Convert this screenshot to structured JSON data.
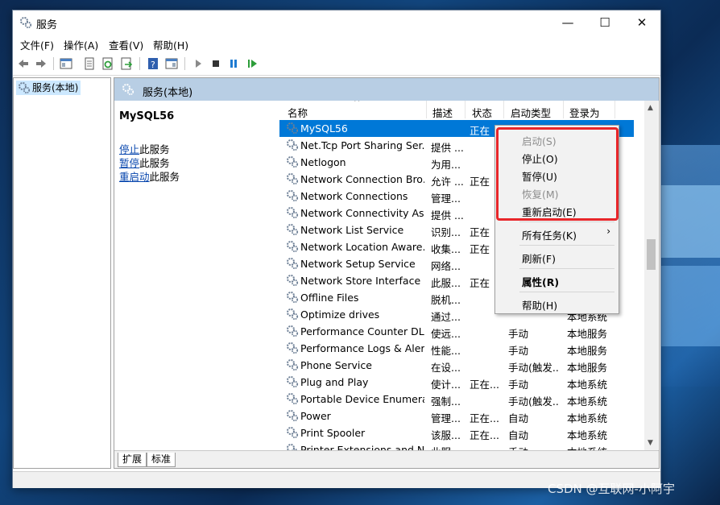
{
  "window": {
    "title": "服务",
    "minimize": "—",
    "maximize": "☐",
    "close": "✕"
  },
  "menu": [
    "文件(F)",
    "操作(A)",
    "查看(V)",
    "帮助(H)"
  ],
  "toolbar": [
    "back-icon",
    "forward-icon",
    "show-hide-tree-icon",
    "properties-icon",
    "refresh-icon",
    "export-icon",
    "help-icon",
    "show-hide-action-pane-icon",
    "start-service-icon",
    "stop-service-icon",
    "pause-service-icon",
    "restart-service-icon"
  ],
  "tree": {
    "label": "服务(本地)"
  },
  "pane": {
    "title": "服务(本地)"
  },
  "desc": {
    "service_name": "MySQL56",
    "actions": [
      {
        "link": "停止",
        "suffix": "此服务"
      },
      {
        "link": "暂停",
        "suffix": "此服务"
      },
      {
        "link": "重启动",
        "suffix": "此服务"
      }
    ]
  },
  "columns": [
    "名称",
    "描述",
    "状态",
    "启动类型",
    "登录为"
  ],
  "rows": [
    {
      "name": "MySQL56",
      "desc": "",
      "status": "正在",
      "start": "",
      "logon": "",
      "selected": true
    },
    {
      "name": "Net.Tcp Port Sharing Ser...",
      "desc": "提供 ...",
      "status": "",
      "start": "",
      "logon": ""
    },
    {
      "name": "Netlogon",
      "desc": "为用...",
      "status": "",
      "start": "",
      "logon": ""
    },
    {
      "name": "Network Connection Bro...",
      "desc": "允许 ...",
      "status": "正在",
      "start": "",
      "logon": ""
    },
    {
      "name": "Network Connections",
      "desc": "管理...",
      "status": "",
      "start": "",
      "logon": ""
    },
    {
      "name": "Network Connectivity Ass...",
      "desc": "提供 ...",
      "status": "",
      "start": "",
      "logon": ""
    },
    {
      "name": "Network List Service",
      "desc": "识别...",
      "status": "正在",
      "start": "",
      "logon": ""
    },
    {
      "name": "Network Location Aware...",
      "desc": "收集...",
      "status": "正在",
      "start": "",
      "logon": ""
    },
    {
      "name": "Network Setup Service",
      "desc": "网络...",
      "status": "",
      "start": "",
      "logon": ""
    },
    {
      "name": "Network Store Interface ...",
      "desc": "此服...",
      "status": "正在",
      "start": "",
      "logon": ""
    },
    {
      "name": "Offline Files",
      "desc": "脱机...",
      "status": "",
      "start": "",
      "logon": ""
    },
    {
      "name": "Optimize drives",
      "desc": "通过...",
      "status": "",
      "start": "",
      "logon": "本地系统"
    },
    {
      "name": "Performance Counter DL...",
      "desc": "使远...",
      "status": "",
      "start": "手动",
      "logon": "本地服务"
    },
    {
      "name": "Performance Logs & Aler...",
      "desc": "性能...",
      "status": "",
      "start": "手动",
      "logon": "本地服务"
    },
    {
      "name": "Phone Service",
      "desc": "在设...",
      "status": "",
      "start": "手动(触发...",
      "logon": "本地服务"
    },
    {
      "name": "Plug and Play",
      "desc": "使计...",
      "status": "正在...",
      "start": "手动",
      "logon": "本地系统"
    },
    {
      "name": "Portable Device Enumera...",
      "desc": "强制...",
      "status": "",
      "start": "手动(触发...",
      "logon": "本地系统"
    },
    {
      "name": "Power",
      "desc": "管理...",
      "status": "正在...",
      "start": "自动",
      "logon": "本地系统"
    },
    {
      "name": "Print Spooler",
      "desc": "该服...",
      "status": "正在...",
      "start": "自动",
      "logon": "本地系统"
    },
    {
      "name": "Printer Extensions and N...",
      "desc": "此服...",
      "status": "",
      "start": "手动",
      "logon": "本地系统"
    }
  ],
  "tabs": [
    "扩展",
    "标准"
  ],
  "context_menu": [
    {
      "label": "启动(S)",
      "disabled": true
    },
    {
      "label": "停止(O)",
      "disabled": false
    },
    {
      "label": "暂停(U)",
      "disabled": false
    },
    {
      "label": "恢复(M)",
      "disabled": true
    },
    {
      "label": "重新启动(E)",
      "disabled": false
    },
    {
      "label": "所有任务(K)",
      "disabled": false,
      "submenu": true
    },
    {
      "label": "刷新(F)",
      "disabled": false
    },
    {
      "label": "属性(R)",
      "disabled": false,
      "bold": true
    },
    {
      "label": "帮助(H)",
      "disabled": false
    }
  ],
  "watermark": "CSDN @互联网-小阿宇",
  "colors": {
    "highlight_box": "#e8262a",
    "selection": "#0078d7",
    "pane_header": "#b8cee4"
  }
}
